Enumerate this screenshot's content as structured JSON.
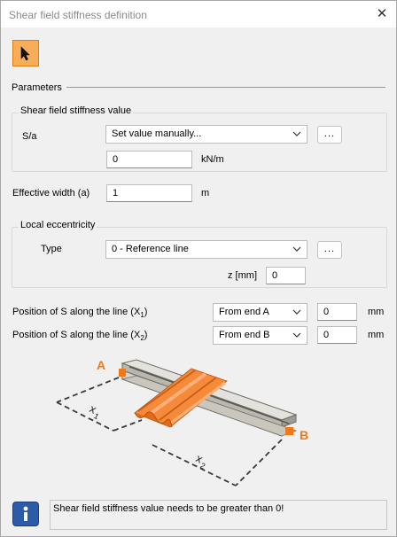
{
  "window": {
    "title": "Shear field stiffness definition",
    "close_glyph": "✕"
  },
  "toolbar": {
    "select_tool_icon": "cursor-arrow-icon"
  },
  "parameters": {
    "heading": "Parameters"
  },
  "stiffness_group": {
    "title": "Shear field stiffness value",
    "sa_label": "S/a",
    "sa_select": "Set value manually...",
    "sa_dots": "...",
    "sa_value": "0",
    "sa_unit": "kN/m"
  },
  "effective_width": {
    "label": "Effective width (a)",
    "value": "1",
    "unit": "m"
  },
  "eccentricity_group": {
    "title": "Local eccentricity",
    "type_label": "Type",
    "type_select": "0 - Reference line",
    "type_dots": "...",
    "z_label": "z [mm]",
    "z_value": "0"
  },
  "position1": {
    "label_prefix": "Position of S along the line (X",
    "label_sub": "1",
    "label_suffix": ")",
    "select": "From end A",
    "value": "0",
    "unit": "mm"
  },
  "position2": {
    "label_prefix": "Position of S along the line (X",
    "label_sub": "2",
    "label_suffix": ")",
    "select": "From end B",
    "value": "0",
    "unit": "mm"
  },
  "diagram": {
    "end_a": "A",
    "end_b": "B",
    "x1_base": "x",
    "x1_sub": "1",
    "x2_base": "x",
    "x2_sub": "2",
    "accent_color": "#f07818",
    "beam_color": "#c8c6bd"
  },
  "status": {
    "icon": "info-icon",
    "message": "Shear field stiffness value needs to be greater than 0!"
  }
}
